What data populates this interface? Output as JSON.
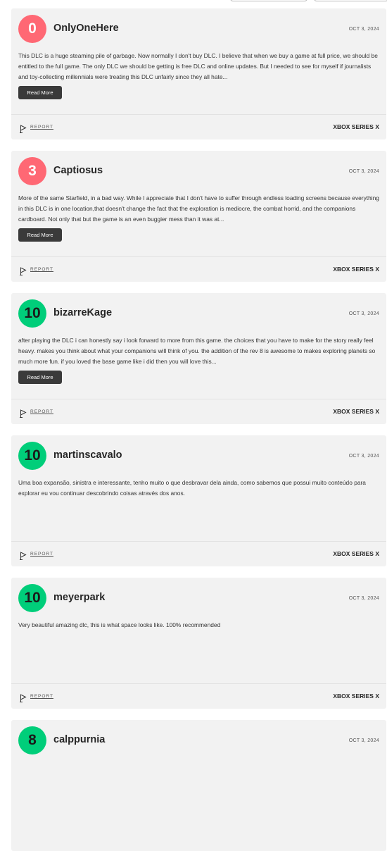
{
  "colors": {
    "negative": "#ff6874",
    "positive": "#00ce7a",
    "card": "#f2f2f2",
    "button": "#3a3a3a"
  },
  "read_more_label": "Read More",
  "report_label": "REPORT",
  "reviews": [
    {
      "score": "0",
      "sentiment": "negative",
      "user": "OnlyOneHere",
      "date": "OCT 3, 2024",
      "text": "This DLC is a huge steaming pile of garbage. Now normally I don't buy DLC. I believe that when we buy a game at full price, we should be entitled to the full game. The only DLC we should be getting is free DLC and online updates. But I needed to see for myself if journalists and toy-collecting millennials were treating this DLC unfairly since they all hate...",
      "read_more": true,
      "platform": "XBOX SERIES X"
    },
    {
      "score": "3",
      "sentiment": "negative",
      "user": "Captiosus",
      "date": "OCT 3, 2024",
      "text": "More of the same Starfield, in a bad way. While I appreciate that I don't have to suffer through endless loading screens because everything in this DLC is in one location,that doesn't change the fact that the exploration is mediocre, the combat horrid, and the companions cardboard. Not only that but the game is an even buggier mess than it was at...",
      "read_more": true,
      "platform": "XBOX SERIES X"
    },
    {
      "score": "10",
      "sentiment": "positive",
      "user": "bizarreKage",
      "date": "OCT 3, 2024",
      "text": "after playing the DLC i can honestly say i look forward to more from this game. the choices that you have to make for the story really feel heavy. makes you think about what your companions will think of you. the addition of the rev 8 is awesome to makes exploring planets so much more fun. if you loved the base game like i did then you will love this...",
      "read_more": true,
      "platform": "XBOX SERIES X"
    },
    {
      "score": "10",
      "sentiment": "positive",
      "user": "martinscavalo",
      "date": "OCT 3, 2024",
      "text": "Uma boa expansão, sinistra e interessante, tenho muito o que desbravar dela ainda, como sabemos que possui muito conteúdo para explorar eu vou continuar descobrindo coisas através dos anos.",
      "read_more": false,
      "platform": "XBOX SERIES X"
    },
    {
      "score": "10",
      "sentiment": "positive",
      "user": "meyerpark",
      "date": "OCT 3, 2024",
      "text": "Very beautiful amazing dlc, this is what space looks like. 100% recommended",
      "read_more": false,
      "platform": "XBOX SERIES X"
    },
    {
      "score": "8",
      "sentiment": "positive",
      "user": "calppurnia",
      "date": "OCT 3, 2024",
      "text": "",
      "read_more": false,
      "platform": ""
    }
  ]
}
